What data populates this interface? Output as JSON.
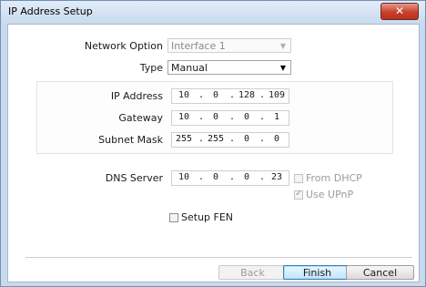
{
  "window": {
    "title": "IP Address Setup",
    "close_glyph": "✕"
  },
  "network_option": {
    "label": "Network Option",
    "value": "Interface 1"
  },
  "type": {
    "label": "Type",
    "value": "Manual"
  },
  "ip_address": {
    "label": "IP Address",
    "octets": [
      "10",
      "0",
      "128",
      "109"
    ]
  },
  "gateway": {
    "label": "Gateway",
    "octets": [
      "10",
      "0",
      "0",
      "1"
    ]
  },
  "subnet_mask": {
    "label": "Subnet Mask",
    "octets": [
      "255",
      "255",
      "0",
      "0"
    ]
  },
  "dns_server": {
    "label": "DNS Server",
    "octets": [
      "10",
      "0",
      "0",
      "23"
    ]
  },
  "from_dhcp": {
    "label": "From DHCP",
    "checked": false
  },
  "use_upnp": {
    "label": "Use UPnP",
    "checked": true
  },
  "setup_fen": {
    "label": "Setup FEN",
    "checked": false
  },
  "buttons": {
    "back": "Back",
    "finish": "Finish",
    "cancel": "Cancel"
  },
  "icons": {
    "dropdown": "chevron-down-icon",
    "checkmark": "checkmark-icon"
  }
}
